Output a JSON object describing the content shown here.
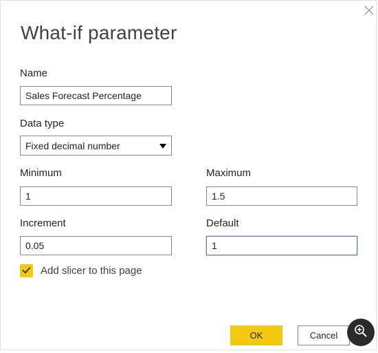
{
  "dialog": {
    "title": "What-if parameter",
    "name_label": "Name",
    "name_value": "Sales Forecast Percentage",
    "data_type_label": "Data type",
    "data_type_value": "Fixed decimal number",
    "minimum_label": "Minimum",
    "minimum_value": "1",
    "maximum_label": "Maximum",
    "maximum_value": "1.5",
    "increment_label": "Increment",
    "increment_value": "0.05",
    "default_label": "Default",
    "default_value": "1",
    "slicer_checkbox_label": "Add slicer to this page",
    "slicer_checked": true,
    "ok_label": "OK",
    "cancel_label": "Cancel"
  },
  "icons": {
    "close": "close-icon",
    "dropdown": "chevron-down-icon",
    "check": "checkmark-icon",
    "zoom": "zoom-in-icon"
  },
  "colors": {
    "accent": "#f2c811",
    "focus_border": "#6b7fa3",
    "input_border": "#8a8886"
  }
}
